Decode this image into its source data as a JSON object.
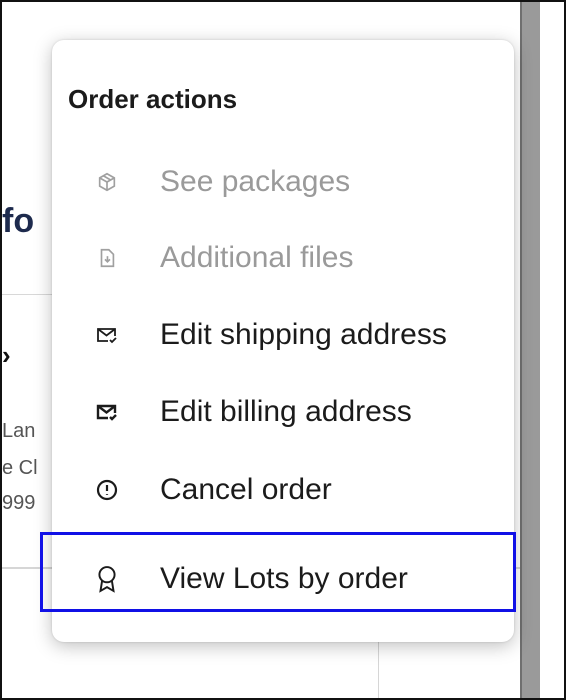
{
  "background": {
    "title_fragment": "fo",
    "arrow_fragment": "›",
    "address_lines": [
      "Lan",
      "e Cl",
      "999"
    ]
  },
  "menu": {
    "title": "Order actions",
    "items": [
      {
        "label": "See packages",
        "icon": "package-icon",
        "disabled": true
      },
      {
        "label": "Additional files",
        "icon": "file-download-icon",
        "disabled": true
      },
      {
        "label": "Edit shipping address",
        "icon": "envelope-check-outline-icon",
        "disabled": false
      },
      {
        "label": "Edit billing address",
        "icon": "envelope-check-icon",
        "disabled": false
      },
      {
        "label": "Cancel order",
        "icon": "alert-circle-icon",
        "disabled": false
      },
      {
        "label": "View Lots by order",
        "icon": "award-ribbon-icon",
        "disabled": false,
        "highlighted": true
      }
    ]
  },
  "colors": {
    "highlight": "#1010e6",
    "disabled_text": "#9a9a9a",
    "text": "#1b1b1b"
  }
}
